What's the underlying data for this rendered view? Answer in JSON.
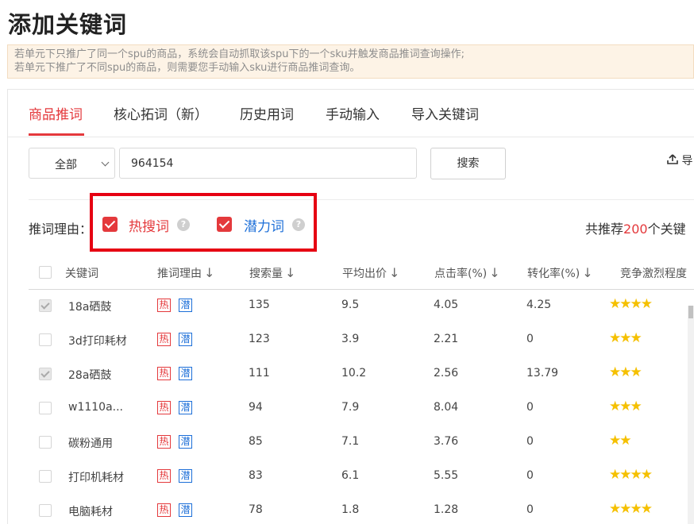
{
  "page": {
    "title": "添加关键词"
  },
  "notice": {
    "line1": "若单元下只推广了同一个spu的商品，系统会自动抓取该spu下的一个sku并触发商品推词查询操作;",
    "line2": "若单元下推广了不同spu的商品，则需要您手动输入sku进行商品推词查询。"
  },
  "tabs": [
    {
      "label": "商品推词",
      "active": true
    },
    {
      "label": "核心拓词（新）"
    },
    {
      "label": "历史用词"
    },
    {
      "label": "手动输入"
    },
    {
      "label": "导入关键词"
    }
  ],
  "search": {
    "scope": "全部",
    "value": "964154",
    "button": "搜索",
    "export": "导"
  },
  "filter": {
    "label": "推词理由：",
    "hot_label": "热搜词",
    "potential_label": "潜力词",
    "help_glyph": "?"
  },
  "summary": {
    "prefix": "共推荐",
    "count": "200",
    "suffix": "个关键"
  },
  "table": {
    "headers": {
      "keyword": "关键词",
      "reason": "推词理由",
      "search_volume": "搜索量",
      "avg_bid": "平均出价",
      "ctr": "点击率(%)",
      "cvr": "转化率(%)",
      "competition": "竞争激烈程度"
    },
    "sort_arrow": "↓",
    "badge_hot": "热",
    "badge_potential": "潜",
    "rows": [
      {
        "keyword": "18a硒鼓",
        "volume": "135",
        "bid": "9.5",
        "ctr": "4.05",
        "cvr": "4.25",
        "stars": "★★★★",
        "checked": true
      },
      {
        "keyword": "3d打印耗材",
        "volume": "123",
        "bid": "3.9",
        "ctr": "2.21",
        "cvr": "0",
        "stars": "★★★",
        "checked": false
      },
      {
        "keyword": "28a硒鼓",
        "volume": "111",
        "bid": "10.2",
        "ctr": "2.56",
        "cvr": "13.79",
        "stars": "★★★",
        "checked": true
      },
      {
        "keyword": "w1110a...",
        "volume": "94",
        "bid": "7.9",
        "ctr": "8.04",
        "cvr": "0",
        "stars": "★★★",
        "checked": false
      },
      {
        "keyword": "碳粉通用",
        "volume": "85",
        "bid": "7.1",
        "ctr": "3.76",
        "cvr": "0",
        "stars": "★★",
        "checked": false
      },
      {
        "keyword": "打印机耗材",
        "volume": "83",
        "bid": "6.1",
        "ctr": "5.55",
        "cvr": "0",
        "stars": "★★★★",
        "checked": false
      },
      {
        "keyword": "电脑耗材",
        "volume": "78",
        "bid": "1.8",
        "ctr": "1.28",
        "cvr": "0",
        "stars": "★★★★",
        "checked": false
      }
    ]
  },
  "colors": {
    "accent": "#e4393c",
    "potential": "#1d6fd8",
    "star": "#f5c000",
    "highlight_box": "#e60012"
  }
}
